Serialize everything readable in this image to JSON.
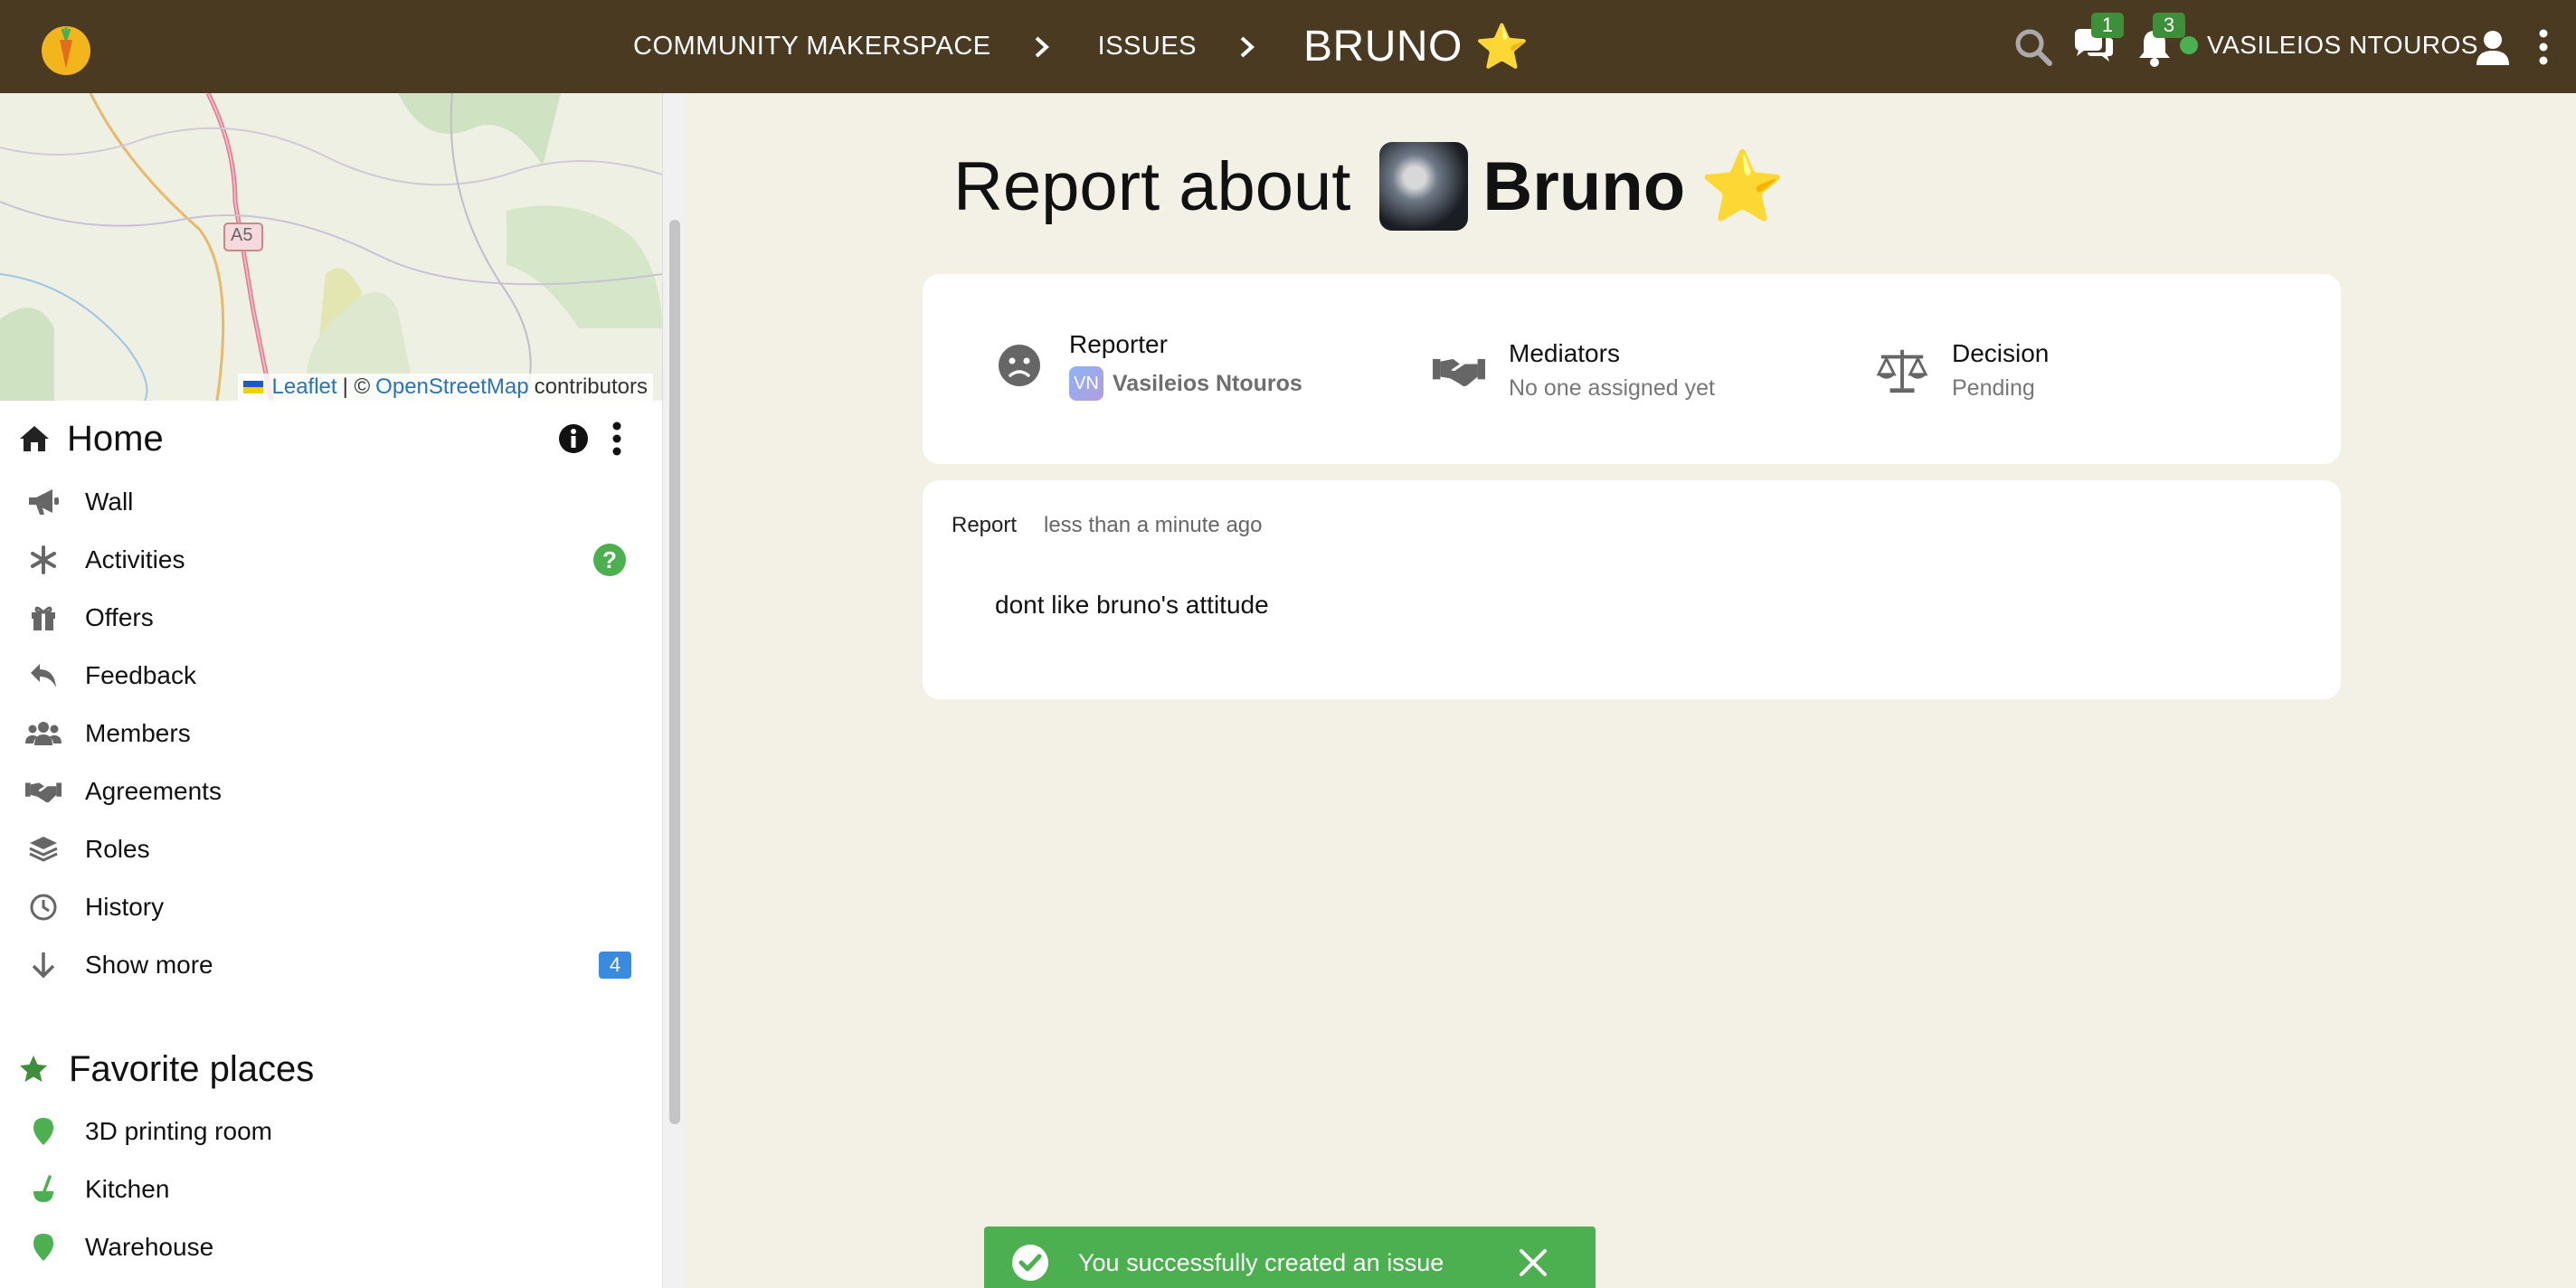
{
  "topbar": {
    "breadcrumb": [
      "COMMUNITY MAKERSPACE",
      "ISSUES"
    ],
    "current": "BRUNO",
    "current_emoji": "⭐",
    "chat_count": "1",
    "notifications_count": "3",
    "user_name": "VASILEIOS NTOUROS"
  },
  "map": {
    "road_label": "A5",
    "attribution": {
      "leaflet": "Leaflet",
      "sep": "| ©",
      "osm": "OpenStreetMap",
      "contributors": "contributors"
    }
  },
  "sidebar": {
    "home_title": "Home",
    "items": [
      {
        "label": "Wall",
        "icon": "megaphone-icon"
      },
      {
        "label": "Activities",
        "icon": "asterisk-icon"
      },
      {
        "label": "Offers",
        "icon": "gift-icon"
      },
      {
        "label": "Feedback",
        "icon": "reply-icon"
      },
      {
        "label": "Members",
        "icon": "users-icon"
      },
      {
        "label": "Agreements",
        "icon": "handshake-icon"
      },
      {
        "label": "Roles",
        "icon": "layers-icon"
      },
      {
        "label": "History",
        "icon": "clock-icon"
      },
      {
        "label": "Show more",
        "icon": "arrow-down-icon"
      }
    ],
    "show_more_badge": "4",
    "activities_help": "?",
    "favorites_title": "Favorite places",
    "favorites": [
      {
        "label": "3D printing room",
        "icon": "map-marker-icon"
      },
      {
        "label": "Kitchen",
        "icon": "ladle-icon"
      },
      {
        "label": "Warehouse",
        "icon": "map-marker-icon"
      }
    ]
  },
  "main": {
    "title_prefix": "Report about",
    "title_name": "Bruno",
    "title_emoji": "⭐",
    "reporter": {
      "label": "Reporter",
      "initials": "VN",
      "name": "Vasileios Ntouros"
    },
    "mediators": {
      "label": "Mediators",
      "value": "No one assigned yet"
    },
    "decision": {
      "label": "Decision",
      "value": "Pending"
    },
    "report": {
      "label": "Report",
      "time": "less than a minute ago",
      "text": "dont like bruno's attitude"
    }
  },
  "toast": {
    "message": "You successfully created an issue"
  },
  "colors": {
    "topbar": "#4a3a22",
    "accent_green": "#4caf50",
    "badge_blue": "#3a8be0",
    "background": "#f3f0e6"
  }
}
